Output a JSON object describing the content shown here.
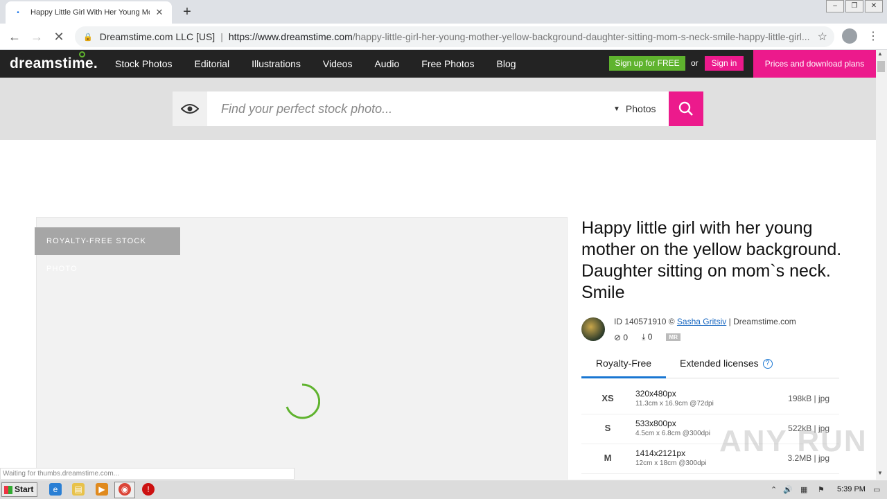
{
  "browser": {
    "tab_title": "Happy Little Girl With Her Young Mot",
    "new_tab": "+",
    "omnibox_org": "Dreamstime.com LLC [US]",
    "omnibox_url_host": "https://www.dreamstime.com",
    "omnibox_url_path": "/happy-little-girl-her-young-mother-yellow-background-daughter-sitting-mom-s-neck-smile-happy-little-girl..."
  },
  "site": {
    "logo": "dreamstime.",
    "nav": [
      "Stock Photos",
      "Editorial",
      "Illustrations",
      "Videos",
      "Audio",
      "Free Photos",
      "Blog"
    ],
    "signup": "Sign up for FREE",
    "or": "or",
    "signin": "Sign in",
    "prices": "Prices and download plans"
  },
  "search": {
    "placeholder": "Find your perfect stock photo...",
    "type": "Photos"
  },
  "image": {
    "badge": "ROYALTY-FREE STOCK PHOTO"
  },
  "photo": {
    "title": "Happy little girl with her young mother on the yellow background. Daughter sitting on mom`s neck. Smile",
    "id_text": "ID 140571910 © ",
    "author": "Sasha Gritsiv",
    "site_suffix": " | Dreamstime.com",
    "views": "0",
    "downloads": "0",
    "mr": "MR"
  },
  "licenses": {
    "tab_royalty": "Royalty-Free",
    "tab_extended": "Extended licenses",
    "help": "?",
    "sizes": [
      {
        "code": "XS",
        "dim": "320x480px",
        "sub": "11.3cm x 16.9cm @72dpi",
        "file": "198kB | jpg"
      },
      {
        "code": "S",
        "dim": "533x800px",
        "sub": "4.5cm x 6.8cm @300dpi",
        "file": "522kB | jpg"
      },
      {
        "code": "M",
        "dim": "1414x2121px",
        "sub": "12cm x 18cm @300dpi",
        "file": "3.2MB | jpg"
      }
    ]
  },
  "watermark": "ANY RUN",
  "status": "Waiting for thumbs.dreamstime.com...",
  "taskbar": {
    "start": "Start",
    "clock": "5:39 PM"
  },
  "colors": {
    "pink": "#ec1a8c",
    "green": "#5fb32e",
    "header": "#232323"
  }
}
